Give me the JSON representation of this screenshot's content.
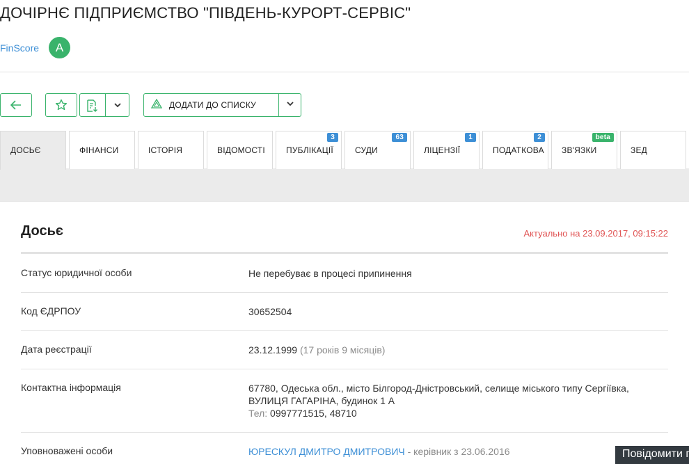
{
  "company": {
    "title": "ДОЧІРНЄ ПІДПРИЄМСТВО \"ПІВДЕНЬ-КУРОРТ-СЕРВІС\"",
    "finscore_label": "FinScore",
    "finscore_grade": "A"
  },
  "toolbar": {
    "back_icon": "arrow-left-icon",
    "favorite_icon": "star-icon",
    "export_icon": "document-download-icon",
    "dropdown_icon": "chevron-down-icon",
    "add_to_list_label": "ДОДАТИ ДО СПИСКУ",
    "add_to_list_icon": "triangle-logo-icon"
  },
  "tabs": [
    {
      "label": "ДОСЬЄ",
      "badge": ""
    },
    {
      "label": "ФІНАНСИ",
      "badge": ""
    },
    {
      "label": "ІСТОРІЯ",
      "badge": ""
    },
    {
      "label": "ВІДОМОСТІ",
      "badge": ""
    },
    {
      "label": "ПУБЛІКАЦІЇ",
      "badge": "3"
    },
    {
      "label": "СУДИ",
      "badge": "63"
    },
    {
      "label": "ЛІЦЕНЗІЇ",
      "badge": "1"
    },
    {
      "label": "ПОДАТКОВА",
      "badge": "2"
    },
    {
      "label": "ЗВ'ЯЗКИ",
      "badge": "beta"
    },
    {
      "label": "ЗЕД",
      "badge": ""
    }
  ],
  "dossier": {
    "title": "Досьє",
    "updated": "Актуально на 23.09.2017, 09:15:22",
    "rows": [
      {
        "label": "Статус юридичної особи",
        "value": "Не перебуває в процесі припинення"
      },
      {
        "label": "Код ЄДРПОУ",
        "value": "30652504"
      },
      {
        "label": "Дата реєстрації",
        "value": "23.12.1999",
        "extra": "(17 років 9 місяців)"
      },
      {
        "label": "Контактна інформація",
        "address_line1": "67780, Одеська обл., місто Білгород-Дністровський, селище міського типу Сергіївка,",
        "address_line2": "ВУЛИЦЯ ГАГАРІНА, будинок 1 А",
        "phone_label": "Тел:",
        "phone_value": "0997771515, 48710"
      },
      {
        "label": "Уповноважені особи",
        "person": "ЮРЕСКУЛ ДМИТРО ДМИТРОВИЧ",
        "role": "- керівник з 23.06.2016"
      }
    ]
  },
  "report_button": "Повідомити п",
  "colors": {
    "accent": "#39b36b",
    "link": "#3d8fd6",
    "updated": "#e05353"
  }
}
